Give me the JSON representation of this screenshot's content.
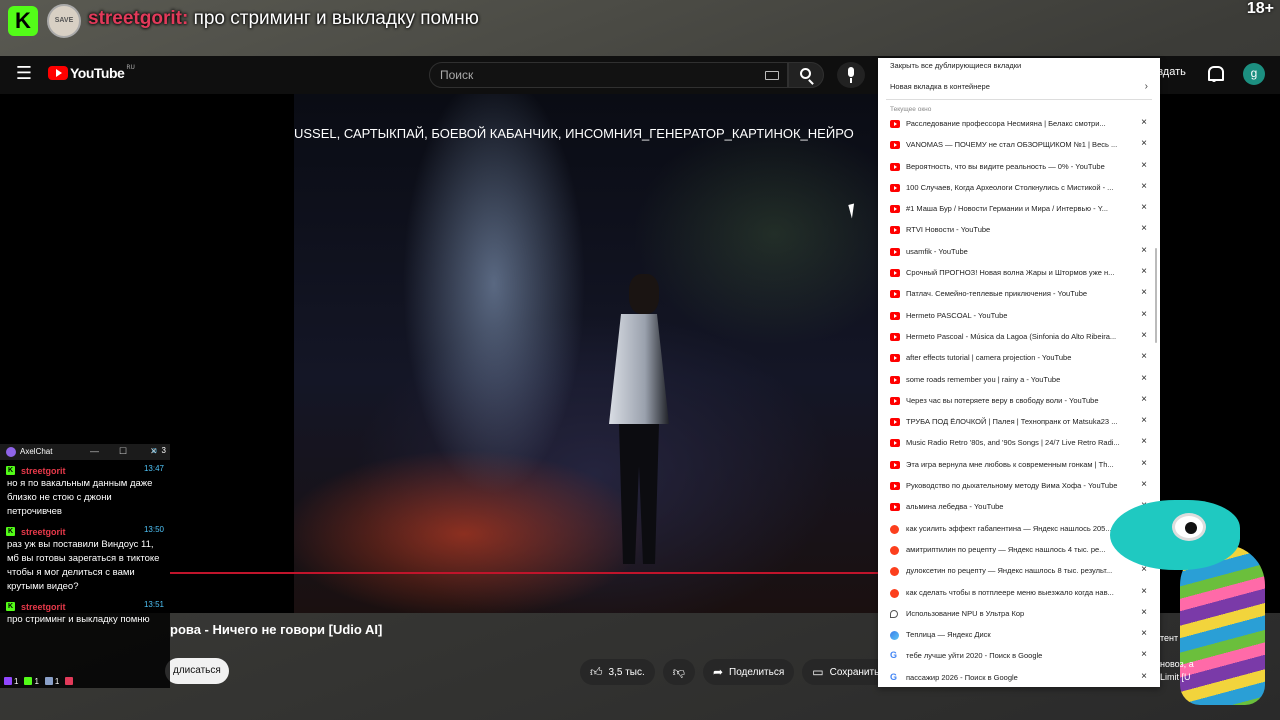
{
  "stream": {
    "nick": "streetgorit:",
    "message": " про стриминг и выкладку помню",
    "age": "18+",
    "avatar_text": "SAVE"
  },
  "youtube": {
    "logo_text": "YouTube",
    "region": "RU",
    "search_placeholder": "Поиск",
    "create_label": "оздать",
    "avatar_letter": "g",
    "video_overlay": "USSEL, САРТЫКПАЙ, БОЕВОЙ КАБАНЧИК, ИНСОМНИЯ_ГЕНЕРАТОР_КАРТИНОК_НЕЙРО",
    "video_title": "рова - Ничего не говори [Udio AI]",
    "subscribe_label": "длисаться",
    "likes": "3,5 тыс.",
    "share_label": "Поделиться",
    "save_label": "Сохранить"
  },
  "tab_panel": {
    "close_duplicates": "Закрыть все дублирующиеся вкладки",
    "new_container_tab": "Новая вкладка в контейнере",
    "section_label": "Текущее окно",
    "close_glyph": "×",
    "tabs": [
      {
        "icon": "youtube",
        "title": "Расследование профессора Несмияна | Белакс смотри..."
      },
      {
        "icon": "youtube",
        "title": "VANOMAS — ПОЧЕМУ не стал ОБЗОРЩИКОМ №1 | Весь ..."
      },
      {
        "icon": "youtube",
        "title": "Вероятность, что вы видите реальность — 0% - YouTube"
      },
      {
        "icon": "youtube",
        "title": "100 Случаев, Когда Археологи Столкнулись с Мистикой - ..."
      },
      {
        "icon": "youtube",
        "title": "#1 Маша Бур / Новости Германии и Мира / Интервью - Y..."
      },
      {
        "icon": "youtube",
        "title": "RTVI Новости - YouTube"
      },
      {
        "icon": "youtube",
        "title": "usamfik - YouTube"
      },
      {
        "icon": "youtube",
        "title": "Срочный ПРОГНОЗ! Новая волна Жары и Штормов уже н..."
      },
      {
        "icon": "youtube",
        "title": "Патлач. Семейно-теплевые приключения - YouTube"
      },
      {
        "icon": "youtube",
        "title": "Hermeto PASCOAL - YouTube"
      },
      {
        "icon": "youtube",
        "title": "Hermeto Pascoal - Música da Lagoa (Sinfonia do Alto Ribeira..."
      },
      {
        "icon": "youtube",
        "title": "after effects tutorial | camera projection - YouTube"
      },
      {
        "icon": "youtube",
        "title": "some roads remember you | rainy a - YouTube"
      },
      {
        "icon": "youtube",
        "title": "Через час вы потеряете веру в свободу воли - YouTube"
      },
      {
        "icon": "youtube",
        "title": "ТРУБА ПОД ЁЛОЧКОЙ | Палея | Технопранк от Matsuka23 ..."
      },
      {
        "icon": "youtube",
        "title": "Music Radio Retro '80s, and '90s Songs | 24/7 Live Retro Radi..."
      },
      {
        "icon": "youtube",
        "title": "Эта игра вернула мне любовь к современным гонкам | Th..."
      },
      {
        "icon": "youtube",
        "title": "Руководство по дыхательному методу Вима Хофа - YouTube"
      },
      {
        "icon": "youtube",
        "title": "альмина лебедва - YouTube"
      },
      {
        "icon": "yandex",
        "title": "как усилить эффект габапентина — Яндекс нашлось 205..."
      },
      {
        "icon": "yandex",
        "title": "амитриптилин по рецепту — Яндекс нашлось 4 тыс. ре..."
      },
      {
        "icon": "yandex",
        "title": "дулоксетин по рецепту — Яндекс нашлось 8 тыс. результ..."
      },
      {
        "icon": "yandex",
        "title": "как сделать чтобы в потплеере меню выезжало когда нав..."
      },
      {
        "icon": "npu",
        "title": "Использование NPU в Ультра Кор"
      },
      {
        "icon": "disk",
        "title": "Теплица — Яндекс Диск"
      },
      {
        "icon": "google",
        "title": "тебе лучше уйти 2020 - Поиск в Google"
      },
      {
        "icon": "google",
        "title": "пассажир 2026 - Поиск в Google"
      }
    ]
  },
  "axelchat": {
    "title": "AxelChat",
    "controls": [
      "—",
      "☐",
      "✕"
    ],
    "messages": [
      {
        "nick": "streetgorit",
        "time": "13:47",
        "text": "но я по вакальным данным даже близко не стою с джони петрочивчев"
      },
      {
        "nick": "streetgorit",
        "time": "13:50",
        "text": "раз уж вы поставили Виндоус 11, мб вы готовы зарегаться в тиктоке чтобы я мог делиться с вами крутыми видео?"
      },
      {
        "nick": "streetgorit",
        "time": "13:51",
        "text": "про стриминг и выкладку помню"
      }
    ],
    "stats": [
      {
        "platform": "twitch",
        "color": "#9146ff",
        "count": "1"
      },
      {
        "platform": "kick",
        "color": "#53fc18",
        "count": "1"
      },
      {
        "platform": "goodgame",
        "color": "#8aa0c8",
        "count": "1"
      },
      {
        "platform": "live",
        "color": "#e23a5a",
        "count": ""
      }
    ],
    "viewers": "3"
  },
  "right_snippets": [
    "тент",
    "новоз, а",
    "Limit [U"
  ]
}
